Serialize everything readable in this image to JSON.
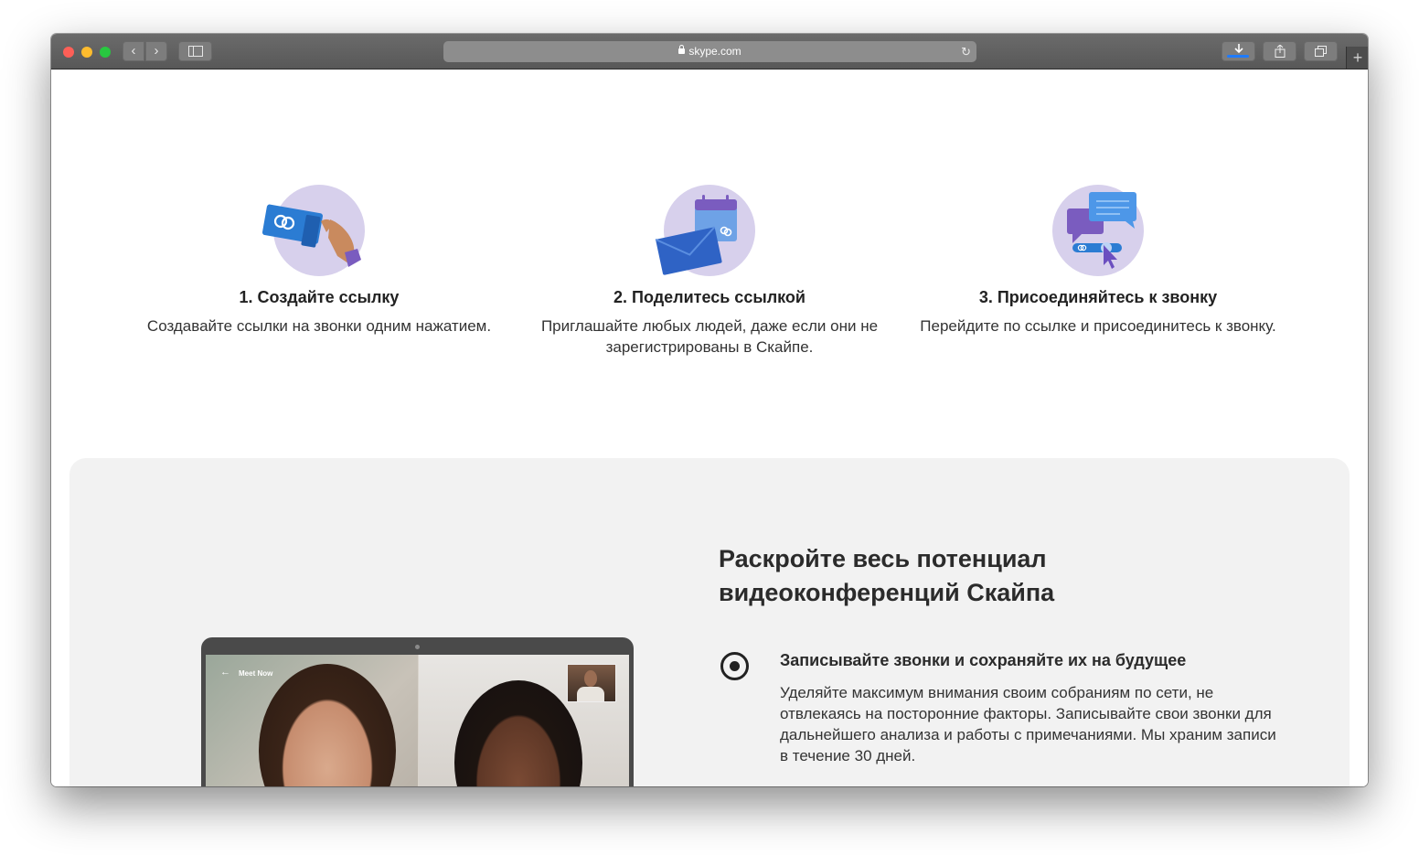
{
  "browser": {
    "url": "skype.com",
    "back_glyph": "‹",
    "forward_glyph": "›",
    "reload_glyph": "↻",
    "new_tab_glyph": "+",
    "icons": [
      "back-chevron-icon",
      "forward-chevron-icon",
      "sidebar-icon",
      "lock-icon",
      "reload-icon",
      "download-icon",
      "share-icon",
      "tabs-overview-icon",
      "new-tab-icon"
    ]
  },
  "steps": [
    {
      "title": "1. Создайте ссылку",
      "desc": "Создавайте ссылки на звонки одним нажатием.",
      "icon": "hand-holding-link-card-icon"
    },
    {
      "title": "2. Поделитесь ссылкой",
      "desc": "Приглашайте любых людей, даже если они не зарегистрированы в Скайпе.",
      "icon": "envelope-calendar-icon"
    },
    {
      "title": "3. Присоединяйтесь к звонку",
      "desc": "Перейдите по ссылке и присоединитесь к звонку.",
      "icon": "chat-bubbles-cursor-icon"
    }
  ],
  "feature": {
    "heading": "Раскройте весь потенциал видеоконференций Скайпа",
    "item": {
      "title": "Записывайте звонки и сохраняйте их на будущее",
      "desc": "Уделяйте максимум внимания своим собраниям по сети, не отвлекаясь на посторонние факторы. Записывайте свои звонки для дальнейшего анализа и работы с примечаниями. Мы храним записи в течение 30 дней.",
      "selected": true
    },
    "laptop": {
      "meeting_label": "Meet Now",
      "back_glyph": "←"
    }
  },
  "colors": {
    "accent_purple": "#d7d0ec",
    "link_blue": "#2b7cd3",
    "feature_bg": "#f2f2f2"
  }
}
